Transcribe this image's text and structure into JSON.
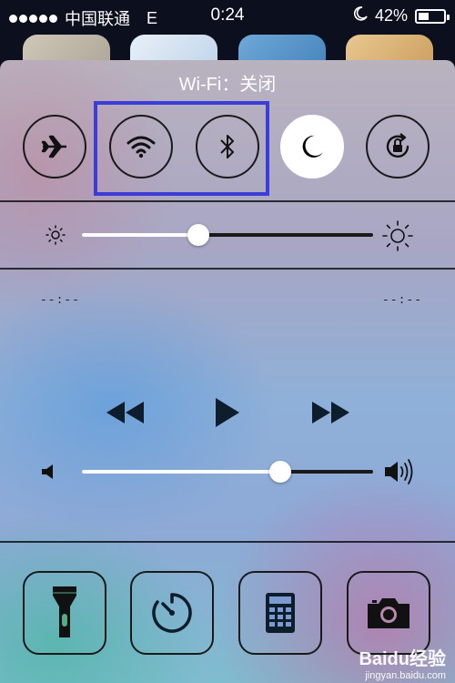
{
  "status_bar": {
    "carrier": "中国联通",
    "network": "E",
    "time": "0:24",
    "battery_percent": "42%",
    "battery_level": 0.42
  },
  "control_center": {
    "wifi_status": "Wi-Fi：关闭",
    "toggles": [
      {
        "name": "airplane-mode",
        "icon": "airplane-icon",
        "on": false
      },
      {
        "name": "wifi",
        "icon": "wifi-icon",
        "on": false
      },
      {
        "name": "bluetooth",
        "icon": "bluetooth-icon",
        "on": false
      },
      {
        "name": "do-not-disturb",
        "icon": "moon-icon",
        "on": true
      },
      {
        "name": "rotation-lock",
        "icon": "rotation-lock-icon",
        "on": false
      }
    ],
    "brightness_level": 0.4,
    "media": {
      "elapsed": "--:--",
      "remaining": "--:--"
    },
    "volume_level": 0.68,
    "apps": [
      {
        "name": "flashlight",
        "icon": "flashlight-icon"
      },
      {
        "name": "clock",
        "icon": "timer-icon"
      },
      {
        "name": "calculator",
        "icon": "calculator-icon"
      },
      {
        "name": "camera",
        "icon": "camera-icon"
      }
    ]
  },
  "watermark": {
    "brand": "Baidu经验",
    "url": "jingyan.baidu.com"
  },
  "colors": {
    "highlight": "#3c3cd8",
    "dark": "#1a1a1a"
  }
}
